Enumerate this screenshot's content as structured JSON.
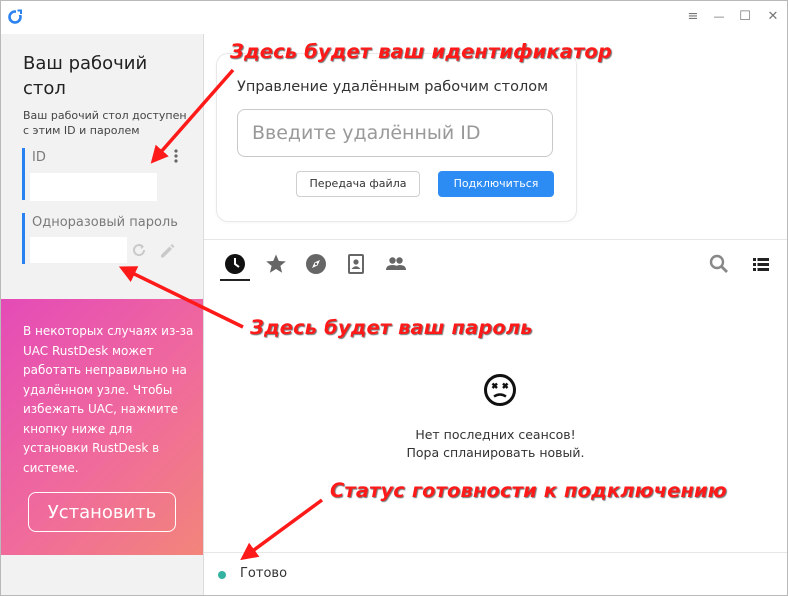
{
  "window": {
    "controls": {
      "menu": "≡",
      "minimize": "—",
      "maximize": "☐",
      "close": "✕"
    }
  },
  "sidebar": {
    "title": "Ваш рабочий стол",
    "description": "Ваш рабочий стол доступен с этим ID и паролем",
    "id_label": "ID",
    "password_label": "Одноразовый пароль",
    "install": {
      "text": "В некоторых случаях из-за UAC RustDesk может работать неправильно на удалённом узле. Чтобы избежать UAC, нажмите кнопку ниже для установки RustDesk в системе.",
      "button_label": "Установить"
    }
  },
  "remote": {
    "title": "Управление удалённым рабочим столом",
    "placeholder": "Введите удалённый ID",
    "transfer_label": "Передача файла",
    "connect_label": "Подключиться"
  },
  "tabs": {
    "icons": [
      "clock-icon",
      "star-icon",
      "compass-icon",
      "address-book-icon",
      "group-icon"
    ],
    "active": "clock-icon"
  },
  "empty": {
    "line1": "Нет последних сеансов!",
    "line2": "Пора спланировать новый."
  },
  "status": {
    "text": "Готово",
    "color": "#34b3a0"
  },
  "annotations": {
    "id_note": "Здесь будет ваш идентификатор",
    "password_note": "Здесь будет ваш пароль",
    "status_note": "Статус готовности к подключению",
    "color": "#ff1a1a"
  }
}
